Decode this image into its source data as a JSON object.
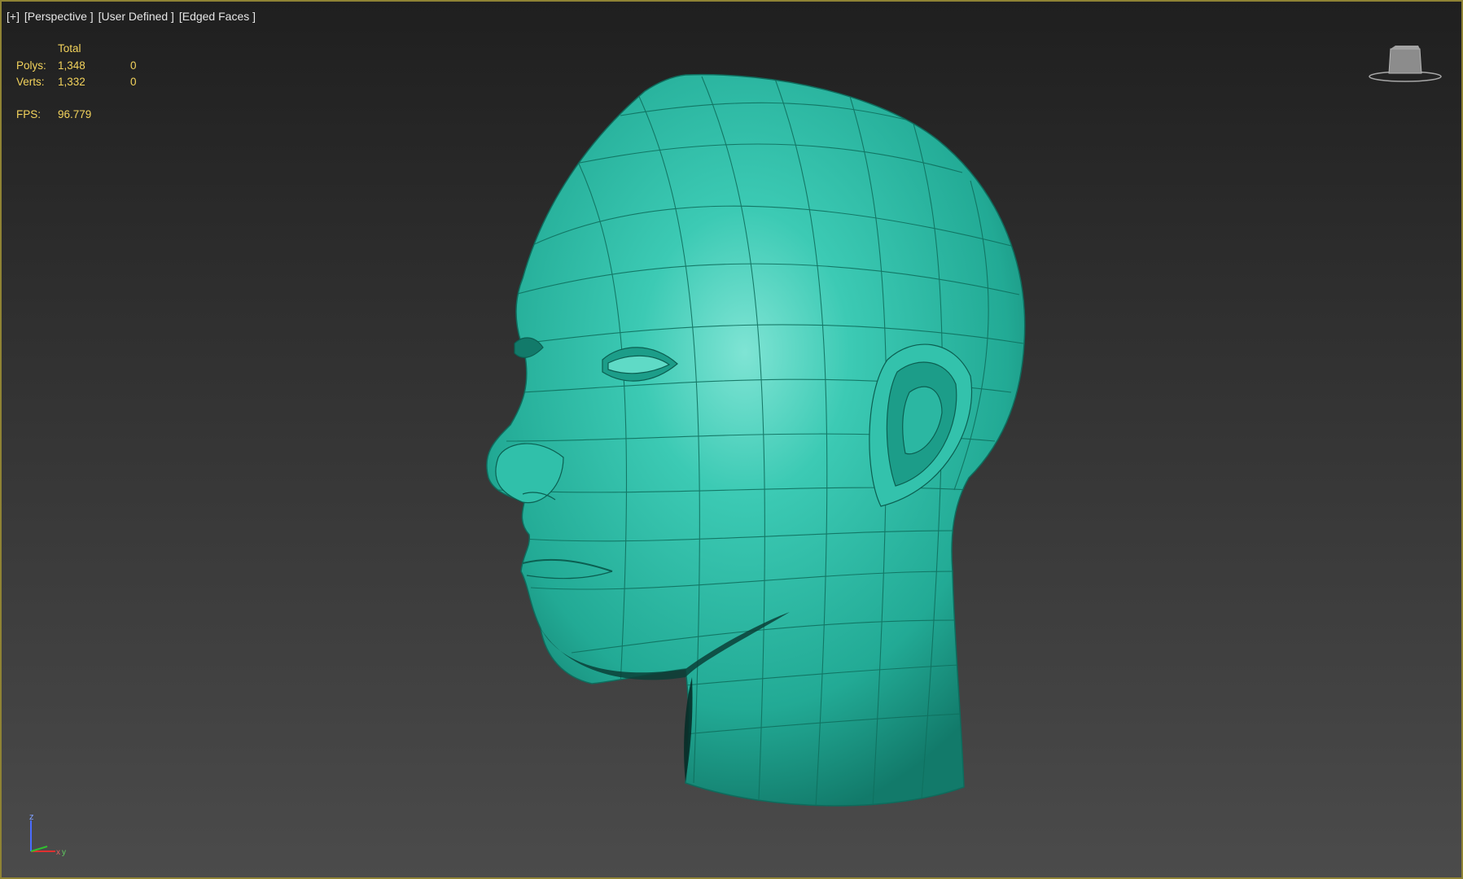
{
  "viewport": {
    "labels": [
      "[+]",
      "[Perspective ]",
      "[User Defined ]",
      "[Edged Faces ]"
    ]
  },
  "stats": {
    "header": "Total",
    "rows": [
      {
        "label": "Polys:",
        "total": "1,348",
        "selected": "0"
      },
      {
        "label": "Verts:",
        "total": "1,332",
        "selected": "0"
      }
    ],
    "fps_label": "FPS:",
    "fps_value": "96.779"
  },
  "viewcube": {
    "icon": "viewcube-icon"
  },
  "axis_gizmo": {
    "z_label": "z",
    "x_label": "x",
    "y_label": "y"
  },
  "colors": {
    "mesh": "#2ec0aa",
    "wire": "#10705f",
    "stats_text": "#f3d35c",
    "viewport_border": "#8f8334"
  }
}
